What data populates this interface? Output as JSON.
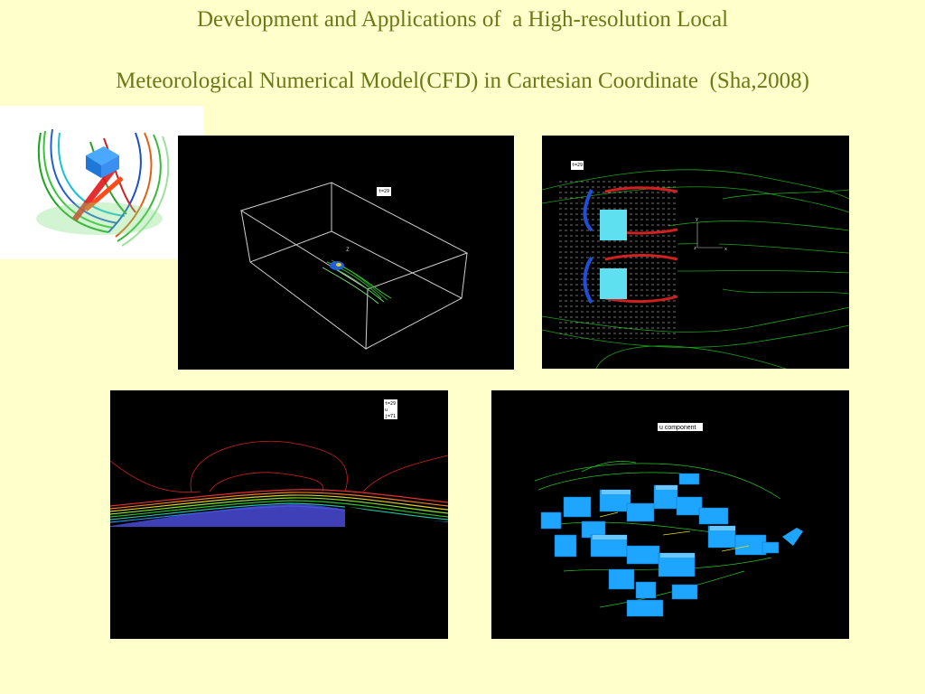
{
  "slide": {
    "title_line1": "Development and Applications of  a High-resolution Local",
    "title_line2": "Meteorological Numerical Model(CFD) in Cartesian Coordinate  (Sha,2008)"
  },
  "panels": {
    "box3d": {
      "label": "t=29"
    },
    "plan": {
      "label": "t=29",
      "axis_y": "y",
      "axis_z": "z",
      "axis_x": "x"
    },
    "section": {
      "label_lines": [
        "t=29",
        "u",
        "j=71"
      ]
    },
    "city": {
      "label": "u component"
    }
  }
}
